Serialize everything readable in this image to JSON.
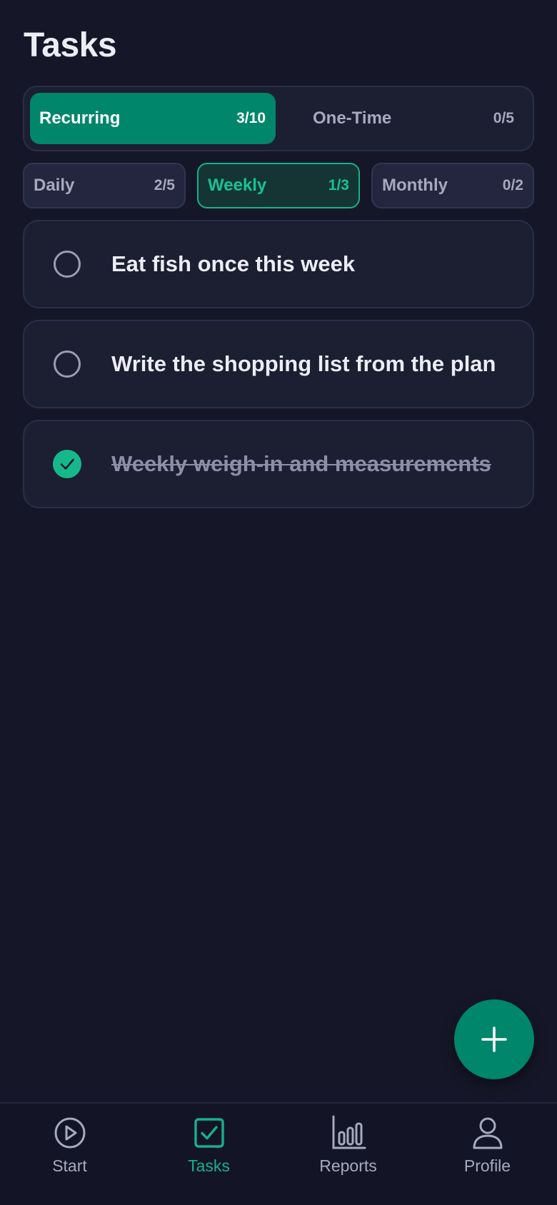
{
  "header": {
    "title": "Tasks"
  },
  "segments": {
    "recurring": {
      "label": "Recurring",
      "count": "3/10"
    },
    "one_time": {
      "label": "One-Time",
      "count": "0/5"
    }
  },
  "filters": {
    "daily": {
      "label": "Daily",
      "count": "2/5"
    },
    "weekly": {
      "label": "Weekly",
      "count": "1/3"
    },
    "monthly": {
      "label": "Monthly",
      "count": "0/2"
    }
  },
  "tasks": [
    {
      "text": "Eat fish once this week",
      "done": false
    },
    {
      "text": "Write the shopping list from the plan",
      "done": false
    },
    {
      "text": "Weekly weigh-in and measurements",
      "done": true
    }
  ],
  "fab": {
    "icon": "plus-icon"
  },
  "nav": {
    "start": {
      "label": "Start",
      "icon": "play-circle-icon"
    },
    "tasks": {
      "label": "Tasks",
      "icon": "checkbox-icon"
    },
    "reports": {
      "label": "Reports",
      "icon": "bar-chart-icon"
    },
    "profile": {
      "label": "Profile",
      "icon": "user-icon"
    }
  },
  "colors": {
    "accent": "#00866A",
    "accent_bright": "#19B08A",
    "background": "#151728",
    "card": "#1C1E32",
    "muted_text": "#A7AABE"
  }
}
